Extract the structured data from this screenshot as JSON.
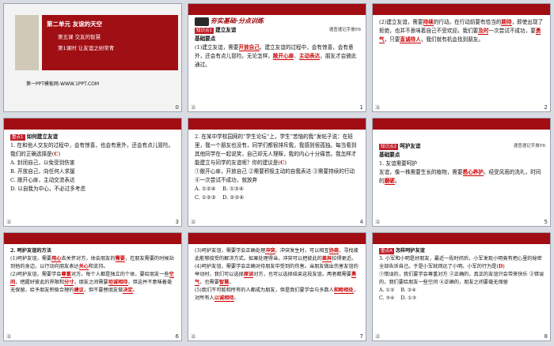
{
  "slides": [
    {
      "num": "0",
      "title_unit": "第二单元 友谊的天空",
      "title_lesson": "第五课 交友的智慧",
      "title_section": "第1课时 让友谊之树常青",
      "footer": "第一PPT模板网-WWW.1PPT.COM"
    },
    {
      "num": "1",
      "tab1": "",
      "tab2": "",
      "banner": "夯实基础·分点训练",
      "tag": "知识点1",
      "heading": "建立友谊",
      "ref": "速查速记手册P8",
      "sub": "基础要点",
      "p1a": "(1)建立友谊，需要",
      "ans1": "开放自己",
      "p1b": "。建立友谊的过程中，会有惊喜，会有意外，还会有点儿冒险。无论怎样，",
      "ans2": "敞开心扉",
      "ans3": "主动表达",
      "p1c": "，朋友才会彼此通过。"
    },
    {
      "num": "2",
      "p1a": "(2)建立友谊，需要",
      "ans1": "持续",
      "p1b": "的行动。在行动前要有恰当的",
      "ans2": "期待",
      "p1c": "，即使出现了拒绝，也并不意味着自己不受欢迎。我们要",
      "ans3": "及时",
      "p1d": "一次尝试不成功，要",
      "ans4": "勇气",
      "p1e": "，只要",
      "ans5": "直诚待人",
      "p1f": "，我们就有机会找到朋友。"
    },
    {
      "num": "3",
      "tag": "重点1",
      "heading": "如何建立友谊",
      "q": "1. 在和他人交友的过程中，会有惊喜，也会有意外，还会有点儿冒险。我们的正确选择是(",
      "ans": "C",
      "q_end": ")",
      "opts": [
        "A. 封闭自己，以免受到伤害",
        "B. 开放自己，向任何人求援",
        "C. 敞开心扉，主动交流表达",
        "D. 以自我为中心，不必过多考虑"
      ]
    },
    {
      "num": "4",
      "q": "2. 在某中学校园网的“学生论坛”上，学生“苦恼的我”发帖子说：在班里，我一个朋友也没有，同学们都很排斥我，我感到很孤独。每当看到其他同学在一起说笑，自己却无人理睬，我的内心十分痛苦。我怎样才能建立与同学的友谊呢？你的建议是(",
      "ans": "C",
      "q_end": ")",
      "items": [
        "①敞开心扉，开放自己  ②需要积极主动的自我表达  ③需要持续的行动  ④一次尝试不成功，就放弃"
      ],
      "opts": [
        "A. ①②④",
        "B. ①③④",
        "C. ①②③",
        "D. ②③④"
      ]
    },
    {
      "num": "5",
      "tag": "知识点2",
      "heading": "呵护友谊",
      "ref": "速查速记手册P8",
      "sub": "基础要点",
      "p1": "1. 友谊需要呵护",
      "p2a": "友谊，像一株需要生长的植物，需要",
      "ans1": "悉心养护",
      "p2b": "。经受风雨的洗礼，时间的",
      "ans2": "磨砺",
      "p2c": "。"
    },
    {
      "num": "6",
      "h": "2. 呵护友谊的方法",
      "p1a": "(1)呵护友谊，需要",
      "ans1": "用心",
      "p1b": "去关怀对方，体会朋友的",
      "ans2": "需要",
      "p1c": "，在朋友需要的时候站到他的身边，以行动向朋友表达",
      "ans3": "关心",
      "p1d": "和支持。",
      "p2a": "(2)呵护友谊，需要学会",
      "ans4": "尊重",
      "p2b": "对方。每个人都是独立的个体，要给朋友一些",
      "ans5": "空间",
      "p2c": "，把握好彼此的界限和",
      "ans6": "分寸",
      "p2d": "，朋友之间需要",
      "ans7": "坦诚相待",
      "p2e": "，但这并不意味着毫无保留，给予朋友积极合理的",
      "ans8": "建议",
      "p2f": "，但不要替朋友做",
      "ans9": "决定",
      "p2g": "。"
    },
    {
      "num": "7",
      "p1a": "(3)呵护友谊，需要学会正确处理",
      "ans1": "冲突",
      "p1b": "。冲突发生时，可以相互",
      "ans2": "协商",
      "p1c": "，寻找彼此能够接受的解决方式。如果处理得当，冲突可以把彼此的",
      "ans3": "差异",
      "p1d": "拉得更近。",
      "p2a": "(4)呵护友谊，需要学会正确对待朋友中受到的伤害。当朋友做出伤害友谊的举动时，我们可以选择",
      "ans4": "原谅",
      "p2b": "对方，也可以选择结束这段友谊。两者都需要",
      "ans5": "勇气",
      "p2c": "，也需要",
      "ans6": "智慧",
      "p2d": "。",
      "p3a": "(5)我们不可能和所有的人都成为朋友，但是我们要学会与多数人",
      "ans7": "和睦相处",
      "p3b": "，对所有人",
      "ans8": "以诚相待",
      "p3c": "。"
    },
    {
      "num": "8",
      "tag": "重点A",
      "heading": "怎样呵护友谊",
      "q": "3. 小军和小明是好朋友，最近一段时间后，小军发现小明竟有把心里的秘密全部告诉自己。于是小军就疏远了小明。小军的行为是(",
      "ans": "D",
      "q_end": ")",
      "items": [
        "①错误的，我们要学会尊重对方  ②正确的，真正的友谊只会带来快乐  ③错误的，我们要给朋友一些空间  ④正确的，朋友之间要毫无保留"
      ],
      "opts": [
        "A. ①②",
        "B. ②④",
        "C. ③④",
        "D. ①③"
      ]
    }
  ],
  "footer_mark": "冶",
  "colors": {
    "accent": "#a10d12",
    "answer": "#cc0000",
    "bg": "#d9dde3"
  }
}
